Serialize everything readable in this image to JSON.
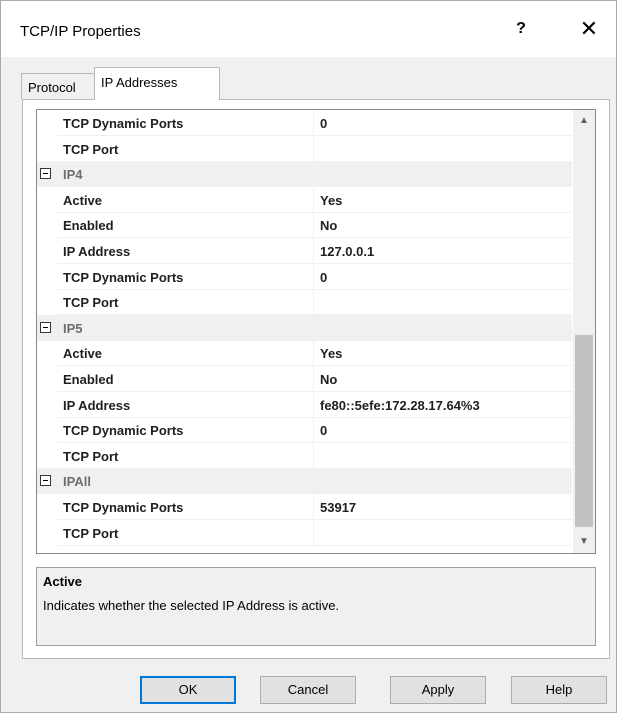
{
  "window": {
    "title": "TCP/IP Properties",
    "help_glyph": "?",
    "close_glyph": "✕"
  },
  "tabs": [
    {
      "label": "Protocol",
      "active": false
    },
    {
      "label": "IP Addresses",
      "active": true
    }
  ],
  "grid": {
    "rows": [
      {
        "kind": "prop",
        "name": "TCP Dynamic Ports",
        "value": "0"
      },
      {
        "kind": "prop",
        "name": "TCP Port",
        "value": ""
      },
      {
        "kind": "cat",
        "name": "IP4"
      },
      {
        "kind": "prop",
        "name": "Active",
        "value": "Yes"
      },
      {
        "kind": "prop",
        "name": "Enabled",
        "value": "No"
      },
      {
        "kind": "prop",
        "name": "IP Address",
        "value": "127.0.0.1"
      },
      {
        "kind": "prop",
        "name": "TCP Dynamic Ports",
        "value": "0"
      },
      {
        "kind": "prop",
        "name": "TCP Port",
        "value": ""
      },
      {
        "kind": "cat",
        "name": "IP5"
      },
      {
        "kind": "prop",
        "name": "Active",
        "value": "Yes"
      },
      {
        "kind": "prop",
        "name": "Enabled",
        "value": "No"
      },
      {
        "kind": "prop",
        "name": "IP Address",
        "value": "fe80::5efe:172.28.17.64%3"
      },
      {
        "kind": "prop",
        "name": "TCP Dynamic Ports",
        "value": "0"
      },
      {
        "kind": "prop",
        "name": "TCP Port",
        "value": ""
      },
      {
        "kind": "cat",
        "name": "IPAll"
      },
      {
        "kind": "prop",
        "name": "TCP Dynamic Ports",
        "value": "53917"
      },
      {
        "kind": "prop",
        "name": "TCP Port",
        "value": ""
      }
    ]
  },
  "description": {
    "title": "Active",
    "text": "Indicates whether the selected IP Address is active."
  },
  "buttons": {
    "ok": "OK",
    "cancel": "Cancel",
    "apply": "Apply",
    "help": "Help"
  },
  "icons": {
    "scroll_up": "scroll-up-arrow-icon",
    "scroll_down": "scroll-down-arrow-icon",
    "collapse": "collapse-minus-icon"
  }
}
